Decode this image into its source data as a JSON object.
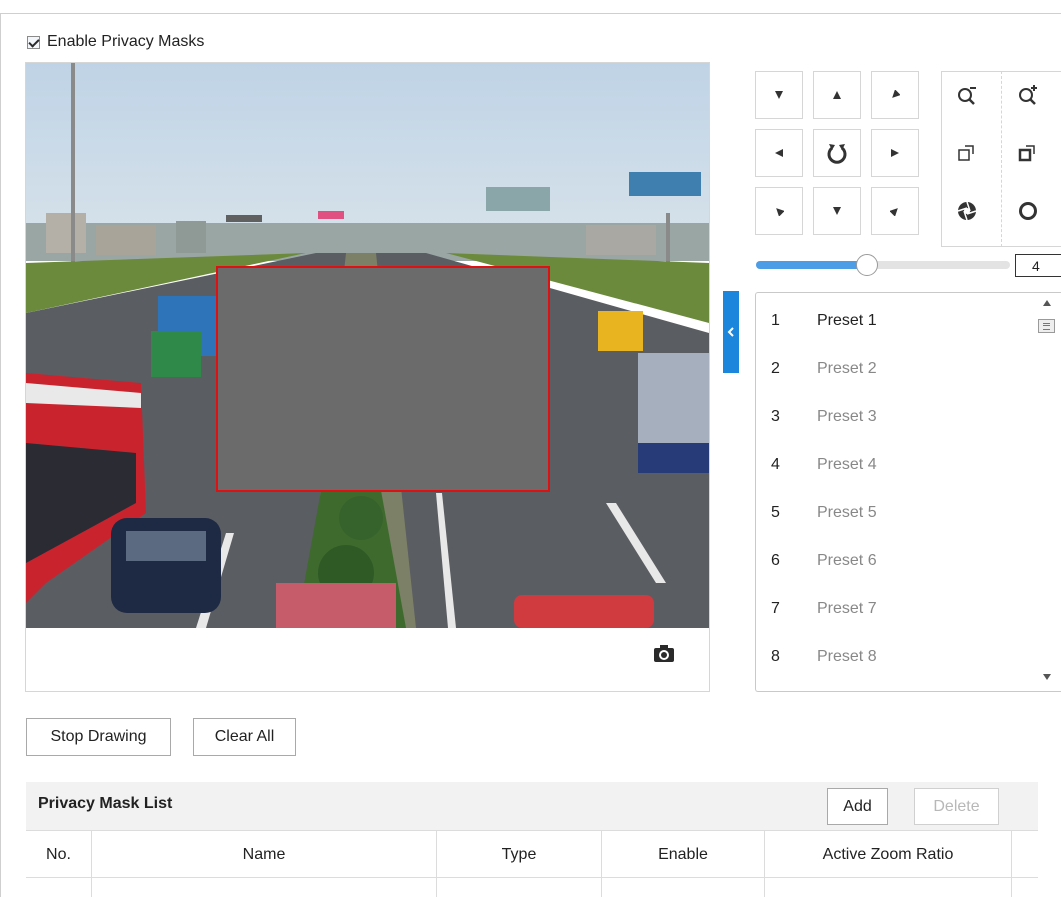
{
  "privacy_mask": {
    "enable_label": "Enable Privacy Masks",
    "enabled": true
  },
  "video": {
    "snapshot_icon": "camera-icon"
  },
  "ptz": {
    "directions": [
      "up-left",
      "up",
      "up-right",
      "left",
      "auto-rotate",
      "right",
      "down-left",
      "down",
      "down-right"
    ],
    "lens_controls": [
      "zoom-out-icon",
      "zoom-in-icon",
      "focus-near-icon",
      "focus-far-icon",
      "iris-close-icon",
      "iris-open-icon"
    ],
    "speed_value": "4",
    "speed_fraction": 0.43
  },
  "presets": [
    {
      "num": "1",
      "name": "Preset 1",
      "active": true
    },
    {
      "num": "2",
      "name": "Preset 2",
      "active": false
    },
    {
      "num": "3",
      "name": "Preset 3",
      "active": false
    },
    {
      "num": "4",
      "name": "Preset 4",
      "active": false
    },
    {
      "num": "5",
      "name": "Preset 5",
      "active": false
    },
    {
      "num": "6",
      "name": "Preset 6",
      "active": false
    },
    {
      "num": "7",
      "name": "Preset 7",
      "active": false
    },
    {
      "num": "8",
      "name": "Preset 8",
      "active": false
    }
  ],
  "drawing": {
    "stop_label": "Stop Drawing",
    "clear_label": "Clear All"
  },
  "mask_list": {
    "title": "Privacy Mask List",
    "add_label": "Add",
    "delete_label": "Delete",
    "columns": [
      "No.",
      "Name",
      "Type",
      "Enable",
      "Active Zoom Ratio",
      ""
    ]
  },
  "colors": {
    "accent": "#1b86dc",
    "slider_fill": "#4d9de6",
    "mask_fill": "#6b6b6b",
    "mask_border": "#dd1111"
  }
}
